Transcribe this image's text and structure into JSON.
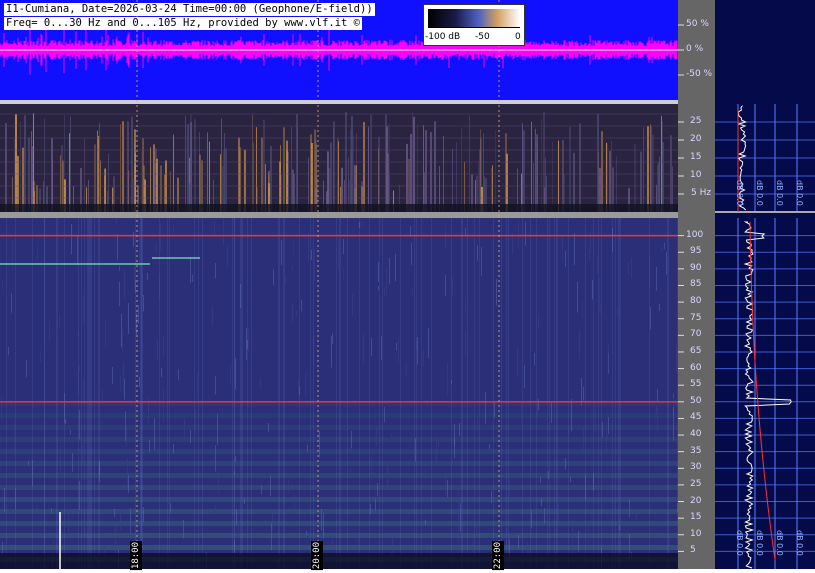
{
  "header": {
    "line1": "I1-Cumiana, Date=2026-03-24 Time=00:00 (Geophone/E-field))",
    "line2": "Freq= 0...30 Hz and 0...105 Hz, provided by www.vlf.it ©"
  },
  "colorbar": {
    "labels": [
      "-100 dB",
      "-50",
      "0"
    ]
  },
  "colors": {
    "amp_bg": "#1010ff",
    "amp_trace": "#ff00ff",
    "spec_bg": "#2a2f78",
    "side_bg": "#050b4a",
    "axis_bg": "#666666",
    "grid": "#5a7cff",
    "red_line": "#ff3030"
  },
  "chart_data": [
    {
      "type": "area",
      "name": "amplitude",
      "ylabel_ticks": [
        "50 %",
        "0 %",
        "-50 %"
      ],
      "ylim": [
        -100,
        100
      ]
    },
    {
      "type": "heatmap",
      "name": "spectrogram-low",
      "ylim": [
        0,
        30
      ],
      "yticks": [
        5,
        10,
        15,
        20,
        25
      ],
      "ytick_labels": [
        "5 Hz",
        "10",
        "15",
        "20",
        "25"
      ]
    },
    {
      "type": "heatmap",
      "name": "spectrogram-high",
      "ylim": [
        0,
        105
      ],
      "yticks": [
        5,
        10,
        15,
        20,
        25,
        30,
        35,
        40,
        45,
        50,
        55,
        60,
        65,
        70,
        75,
        80,
        85,
        90,
        95,
        100
      ],
      "ytick_labels": [
        "5",
        "10",
        "15",
        "20",
        "25",
        "30",
        "35",
        "40",
        "45",
        "50",
        "55",
        "60",
        "65",
        "70",
        "75",
        "80",
        "85",
        "90",
        "95",
        "100"
      ],
      "x_time_labels": [
        "18:00",
        "20:00",
        "22:00"
      ],
      "strong_lines_hz": [
        50,
        100
      ]
    }
  ],
  "side_panels": {
    "low_labels": [
      "dB 0.0",
      "dB 0.0",
      "dB 0.0",
      "dB 0.0"
    ],
    "high_labels": [
      "dB 0.0",
      "dB 0.0",
      "dB 0.0",
      "dB 0.0"
    ]
  }
}
